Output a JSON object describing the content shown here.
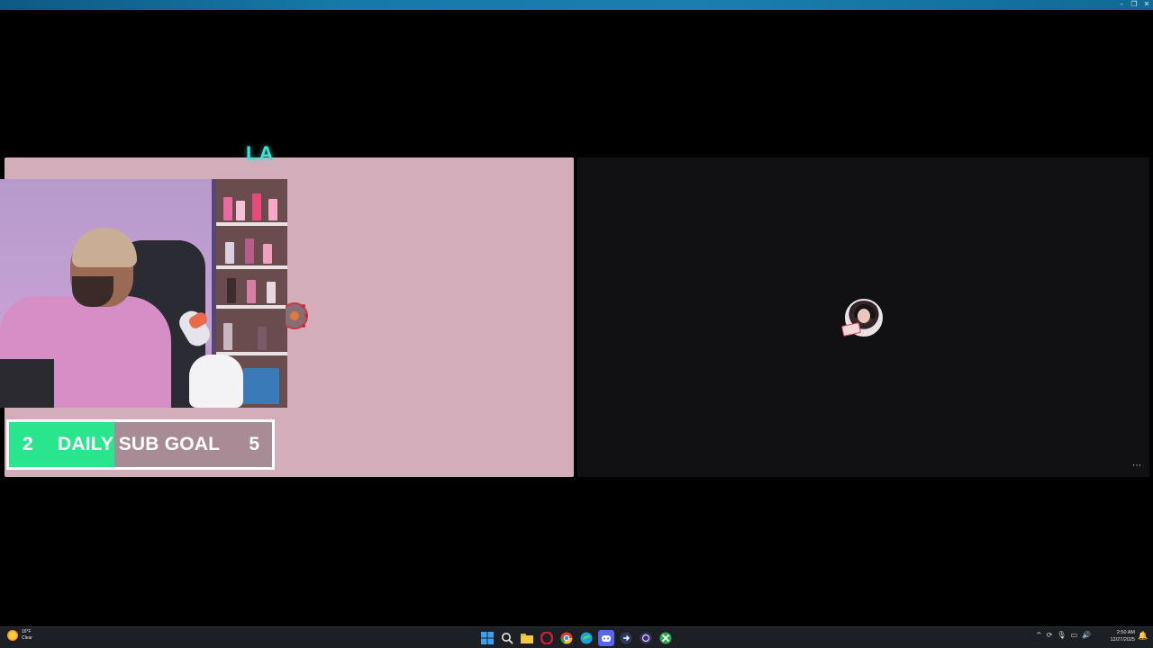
{
  "window": {
    "controls": [
      "–",
      "❐",
      "✕"
    ]
  },
  "stream": {
    "overlay_text": "LA",
    "sub_goal": {
      "current": "2",
      "label": "DAILY SUB GOAL",
      "target": "5",
      "progress_fraction": 0.4,
      "fill_color": "#29e58e"
    }
  },
  "right_pane": {
    "more_label": "⋯"
  },
  "taskbar": {
    "weather": {
      "temp": "16°F",
      "condition": "Clear"
    },
    "pinned_icons": [
      "windows-start-icon",
      "search-icon",
      "file-explorer-icon",
      "opera-icon",
      "chrome-icon",
      "edge-icon",
      "discord-icon",
      "app-arrow-icon",
      "obs-icon",
      "xbox-icon"
    ],
    "tray": {
      "chevron": "^",
      "sync": "⟳",
      "mic": "🎙",
      "network": "▭",
      "volume": "🔊"
    },
    "clock": {
      "time": "2:50 AM",
      "date": "12/27/2025"
    },
    "notification": "🔔"
  }
}
